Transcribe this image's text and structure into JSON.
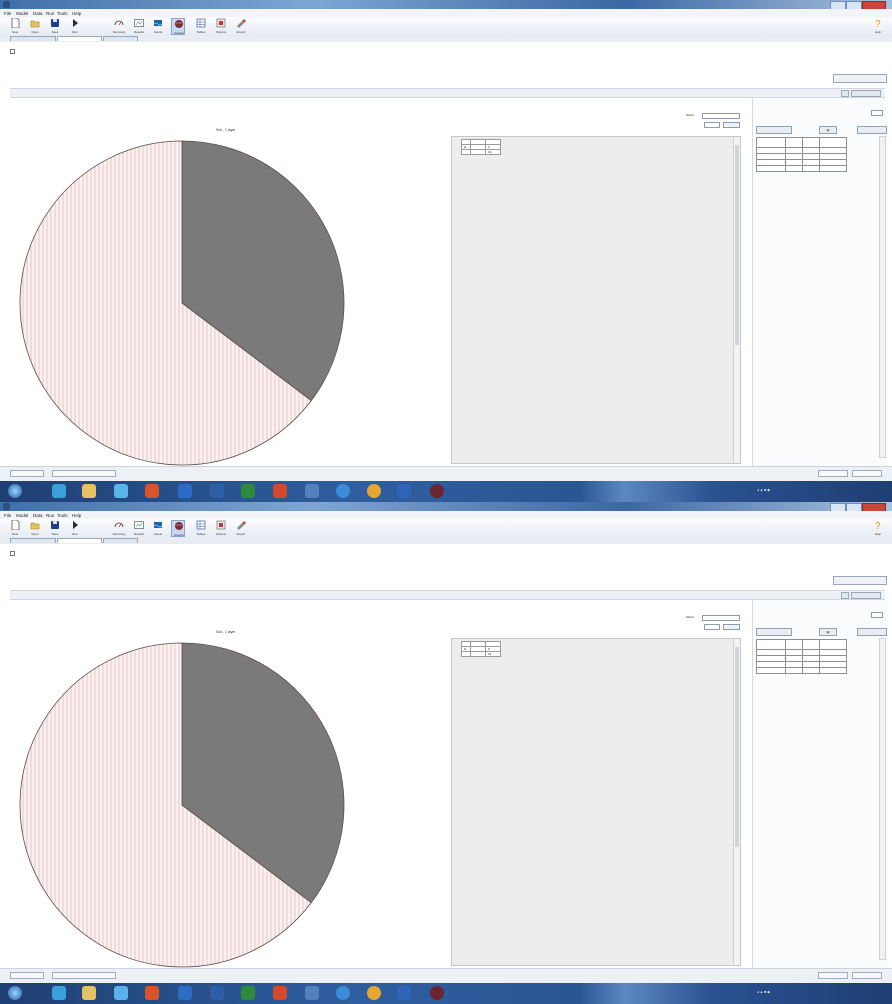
{
  "window": {
    "title": "",
    "controls": [
      "minimize",
      "maximize",
      "close"
    ]
  },
  "menu": [
    "File",
    "Model",
    "Data",
    "Run",
    "Tools",
    "Help"
  ],
  "toolbar": [
    "New",
    "Open",
    "Save",
    "Run",
    "Summary",
    "Results",
    "Inputs",
    "Graphs",
    "Tables",
    "Options",
    "Export"
  ],
  "toolbar_help": "Help",
  "tabs": [
    "",
    "",
    ""
  ],
  "top_row1": "",
  "top_row2": "",
  "load_button": "",
  "left_panel": {
    "header": "",
    "show_label": "Show:",
    "show_value": "",
    "select_label": "",
    "chart_title": "Soil - 1 layer"
  },
  "chart_data": {
    "type": "pie",
    "values": [
      35.3,
      64.7
    ],
    "colors": [
      "#7a7a7a",
      "#e9cfcf"
    ],
    "start_angle_deg": 0
  },
  "mini_table": {
    "headers": [
      "",
      ""
    ],
    "rows": [
      [
        "",
        "0"
      ],
      [
        "",
        "19"
      ]
    ]
  },
  "right_panel": {
    "title": "",
    "subtitle": "",
    "button1": "",
    "button2": "",
    "table_headers": [
      "",
      "",
      "",
      ""
    ],
    "table_rows": [
      [
        "",
        "",
        "",
        ""
      ],
      [
        "",
        "",
        "",
        ""
      ],
      [
        "",
        "",
        "",
        ""
      ],
      [
        "",
        "",
        "",
        ""
      ]
    ]
  },
  "status": {
    "left": "",
    "middle": "",
    "right1": "",
    "right2": ""
  },
  "tray": {
    "time": "",
    "date": ""
  },
  "taskbar_apps": [
    "start-orb",
    "ie",
    "explorer",
    "ie2",
    "office",
    "outlook",
    "word",
    "excel",
    "powerpoint",
    "onenote",
    "chrome",
    "media",
    "app",
    "app2"
  ]
}
